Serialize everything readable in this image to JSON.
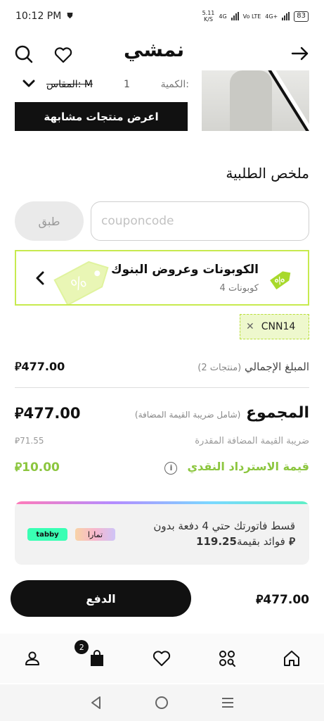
{
  "status_bar": {
    "time": "10:12 PM",
    "net_speed_value": "5.11",
    "net_speed_unit": "K/S",
    "net1": "4G",
    "net2": "Vo LTE",
    "net3": "4G+",
    "battery": "83"
  },
  "header": {
    "logo": "نمشي"
  },
  "product": {
    "quantity_label": "الكمية:",
    "quantity_value": "1",
    "size_label": "المقاس: M",
    "similar_button": "اعرض منتجات مشابهة"
  },
  "summary": {
    "title": "ملخص الطلبية",
    "coupon_placeholder": "couponcode",
    "apply_button": "طبق",
    "bank_offers_title": "الكوبونات وعروض البنوك",
    "bank_offers_count": "4 كوبونات",
    "applied_coupon": "CNN14",
    "subtotal_label": "المبلغ الإجمالي",
    "subtotal_items": "(2 منتجات)",
    "subtotal_amount": "477.00",
    "grand_total_label": "المجموع",
    "grand_total_note": "(شامل ضريبة القيمة المضافة)",
    "grand_total_amount": "477.00",
    "vat_label": "ضريبة القيمة المضافة المقدرة",
    "vat_amount": "71.55",
    "cashback_label": "قيمة الاسترداد النقدي",
    "cashback_amount": "10.00",
    "currency_symbol": "⃁"
  },
  "installments": {
    "text_line1": "قسط فاتورتك حتي 4 دفعة بدون",
    "text_line2": "فوائد بقيمة",
    "amount": "119.25",
    "tabby_label": "tabby",
    "tamara_label": "تمارا"
  },
  "checkout": {
    "pay_button": "الدفع",
    "total": "477.00"
  },
  "bottom_nav": {
    "cart_count": "2"
  },
  "colors": {
    "accent_green": "#c7ea4f",
    "cash_green": "#8cc63f",
    "primary": "#111111"
  }
}
